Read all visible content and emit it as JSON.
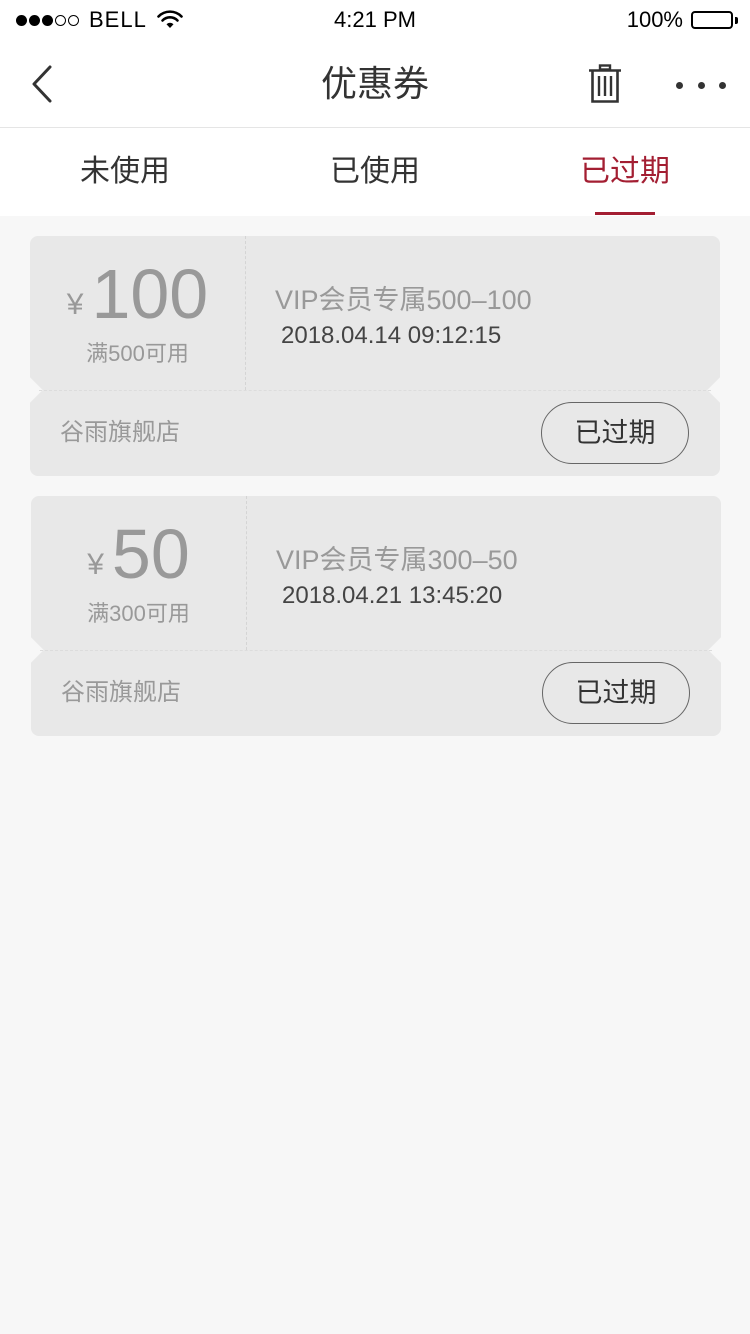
{
  "status_bar": {
    "carrier": "BELL",
    "time": "4:21 PM",
    "battery": "100%",
    "battery_level": 1.0
  },
  "nav": {
    "title": "优惠券",
    "back_icon": "chevron-left-icon",
    "trash_icon": "trash-icon",
    "more_icon": "more-horizontal-icon"
  },
  "tabs": [
    {
      "label": "未使用",
      "active": false
    },
    {
      "label": "已使用",
      "active": false
    },
    {
      "label": "已过期",
      "active": true
    }
  ],
  "colors": {
    "accent": "#a31e32",
    "background": "#f7f7f7",
    "card": "#e8e8e8"
  },
  "coupons": [
    {
      "currency": "¥",
      "amount": "100",
      "condition": "满500可用",
      "name": "VIP会员专属500–100",
      "date": "2018.04.14 09:12:15",
      "store": "谷雨旗舰店",
      "status": "已过期"
    },
    {
      "currency": "¥",
      "amount": "50",
      "condition": "满300可用",
      "name": "VIP会员专属300–50",
      "date": "2018.04.21 13:45:20",
      "store": "谷雨旗舰店",
      "status": "已过期"
    }
  ]
}
